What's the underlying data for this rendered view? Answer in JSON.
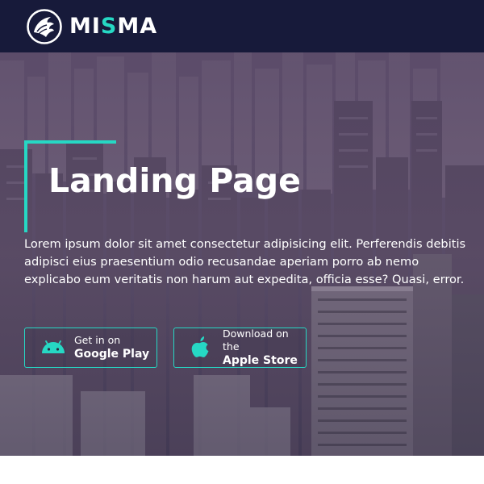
{
  "navbar": {
    "brand_prefix": "MI",
    "brand_accent": "S",
    "brand_suffix": "MA"
  },
  "hero": {
    "title": "Landing Page",
    "description": "Lorem ipsum dolor sit amet consectetur adipisicing elit. Perferendis debitis adipisci eius praesentium odio recusandae aperiam porro ab nemo explicabo eum veritatis non harum aut expedita, officia esse? Quasi, error."
  },
  "buttons": {
    "google": {
      "small": "Get in on",
      "big": "Google Play",
      "icon": "android-icon"
    },
    "apple": {
      "small": "Download on the",
      "big": "Apple Store",
      "icon": "apple-icon"
    }
  },
  "colors": {
    "navbar_bg": "#171a3a",
    "accent": "#26d8c4",
    "text": "#ffffff"
  }
}
